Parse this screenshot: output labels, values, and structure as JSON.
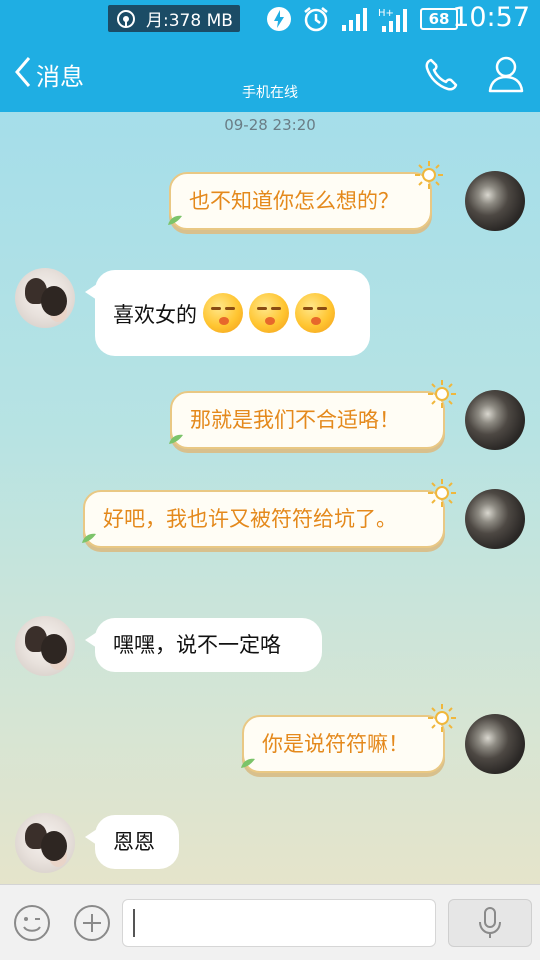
{
  "status_bar": {
    "data_usage": "月:378 MB",
    "battery": "68",
    "time": "10:57",
    "network": "H+"
  },
  "header": {
    "back_label": "消息",
    "subtitle": "手机在线"
  },
  "chat": {
    "timestamp": "09-28 23:20",
    "messages": [
      {
        "sender": "me",
        "text": "也不知道你怎么想的？"
      },
      {
        "sender": "friend",
        "text": "喜欢女的",
        "emoji_count": 3
      },
      {
        "sender": "me",
        "text": "那就是我们不合适咯！"
      },
      {
        "sender": "me",
        "text": "好吧，我也许又被符符给坑了。"
      },
      {
        "sender": "friend",
        "text": "嘿嘿，说不一定咯"
      },
      {
        "sender": "me",
        "text": "你是说符符嘛！"
      },
      {
        "sender": "friend",
        "text": "恩恩"
      }
    ]
  },
  "input_bar": {
    "field_value": ""
  },
  "colors": {
    "accent": "#1faee3",
    "outgoing_text": "#e4891c",
    "outgoing_border": "#e9c884"
  }
}
